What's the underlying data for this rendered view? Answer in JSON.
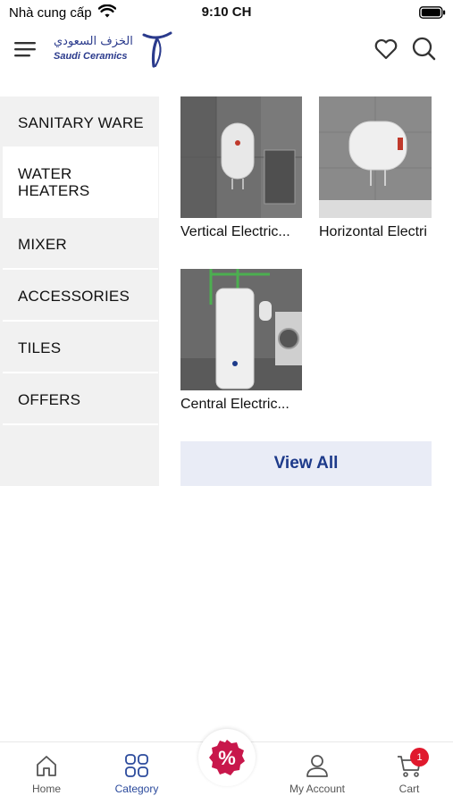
{
  "status": {
    "carrier": "Nhà cung cấp",
    "time": "9:10 CH"
  },
  "header": {
    "logo_ar": "الخزف السعودي",
    "logo_en": "Saudi Ceramics"
  },
  "sidebar": {
    "items": [
      {
        "label": "SANITARY WARE"
      },
      {
        "label": "WATER HEATERS",
        "active": true
      },
      {
        "label": "MIXER"
      },
      {
        "label": "ACCESSORIES"
      },
      {
        "label": "TILES"
      },
      {
        "label": "OFFERS"
      }
    ]
  },
  "products": [
    {
      "name": "Vertical Electric..."
    },
    {
      "name": "Horizontal Electri"
    },
    {
      "name": "Central Electric..."
    }
  ],
  "view_all_label": "View All",
  "tabbar": {
    "home": "Home",
    "category": "Category",
    "account": "My Account",
    "cart": "Cart",
    "cart_count": "1",
    "offers_symbol": "%"
  },
  "colors": {
    "accent": "#2b4a9c",
    "badge": "#e0192d",
    "offers": "#c8174b"
  }
}
